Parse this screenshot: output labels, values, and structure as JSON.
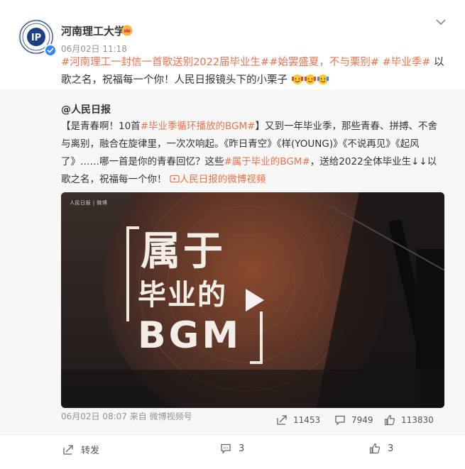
{
  "post": {
    "author": "河南理工大学",
    "time": "06月02日 11:18",
    "text": {
      "tag1": "#河南理工一封信一首歌送别2022届毕业生#",
      "tag2": "#始罢盛夏，不与栗别#",
      "tag3": "#毕业季#",
      "plain": " 以歌之名，祝福每一个你！人民日报镜头下的小栗子"
    }
  },
  "repost": {
    "author": "@人民日报",
    "text": {
      "p1": "【是青春啊！10首",
      "tag1": "#毕业季循环播放的BGM#",
      "p2": "】又到一年毕业季，那些青春、拼搏、不舍与离别，融合在旋律里，一次次响起。《昨日青空》《样(YOUNG)》《不说再见》《起风了》……哪一首是你的青春回忆？这些",
      "tag2": "#属于毕业的BGM#",
      "p3": "，送给2022全体毕业生↓↓以歌之名，祝福每一个你！",
      "link": "人民日报的微博视频"
    },
    "video": {
      "logo": "人民日报 | 微博",
      "title_line1": "属于",
      "title_line2": "毕业的",
      "title_line3": "BGM"
    },
    "meta": "06月02日 08:07 来自 微博视频号",
    "reposts": "11453",
    "comments": "7949",
    "likes": "113830"
  },
  "actions": {
    "repost_label": "转发",
    "comments": "3",
    "likes": "3"
  },
  "colors": {
    "accent": "#eb7350",
    "verified": "#2f86f6",
    "repost_bg": "#f7f7f7"
  }
}
